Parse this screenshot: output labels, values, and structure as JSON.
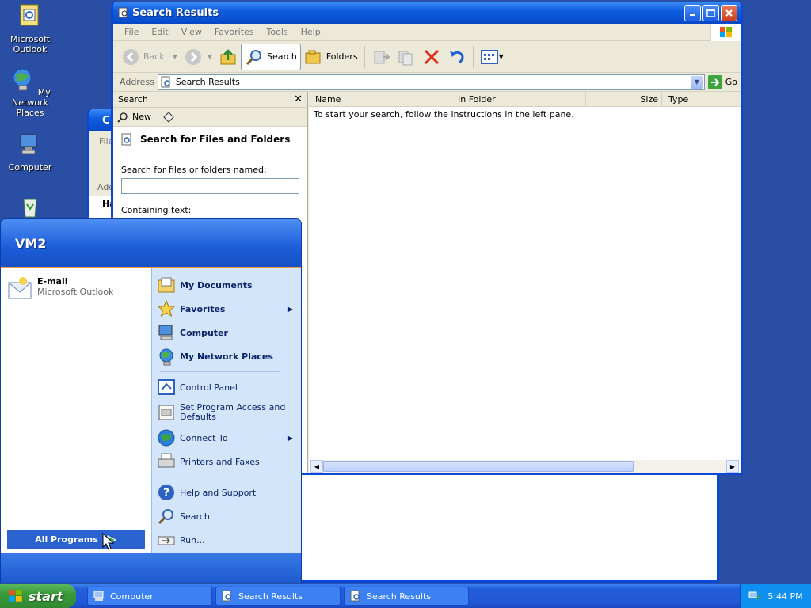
{
  "desktop": {
    "icons": [
      {
        "name": "outlook",
        "label": "Microsoft Outlook"
      },
      {
        "name": "network",
        "label": "My Network Places"
      },
      {
        "name": "computer",
        "label": "Computer"
      },
      {
        "name": "recycle",
        "label": ""
      }
    ]
  },
  "back_window": {
    "title_fragment": "C",
    "menu_fragment": "File",
    "address_fragment": "Addr",
    "row_fragment": "Ha"
  },
  "search_window": {
    "title": "Search Results",
    "menu": [
      "File",
      "Edit",
      "View",
      "Favorites",
      "Tools",
      "Help"
    ],
    "toolbar": {
      "back": "Back",
      "search": "Search",
      "folders": "Folders"
    },
    "address_label": "Address",
    "address_value": "Search Results",
    "go_label": "Go",
    "pane": {
      "header": "Search",
      "new_label": "New",
      "title": "Search for Files and Folders",
      "named_label": "Search for files or folders named:",
      "named_value": "",
      "containing_label": "Containing text:"
    },
    "columns": [
      "Name",
      "In Folder",
      "Size",
      "Type"
    ],
    "message": "To start your search, follow the instructions in the left pane."
  },
  "start_menu": {
    "user": "VM2",
    "pinned": {
      "title": "E-mail",
      "subtitle": "Microsoft Outlook"
    },
    "all_programs": "All Programs",
    "right_items": [
      {
        "label": "My Documents"
      },
      {
        "label": "Favorites"
      },
      {
        "label": "Computer"
      },
      {
        "label": "My Network Places"
      },
      {
        "label": "Control Panel"
      },
      {
        "label": "Set Program Access and Defaults"
      },
      {
        "label": "Connect To"
      },
      {
        "label": "Printers and Faxes"
      },
      {
        "label": "Help and Support"
      },
      {
        "label": "Search"
      },
      {
        "label": "Run..."
      }
    ]
  },
  "taskbar": {
    "start_label": "start",
    "tasks": [
      {
        "label": "Computer"
      },
      {
        "label": "Search Results"
      },
      {
        "label": "Search Results"
      }
    ],
    "clock": "5:44 PM"
  },
  "colors": {
    "desktop": "#2a4ea3",
    "title_blue": "#0a4fd0",
    "start_green": "#3a9a3a",
    "menu_right": "#d3e5fa"
  }
}
